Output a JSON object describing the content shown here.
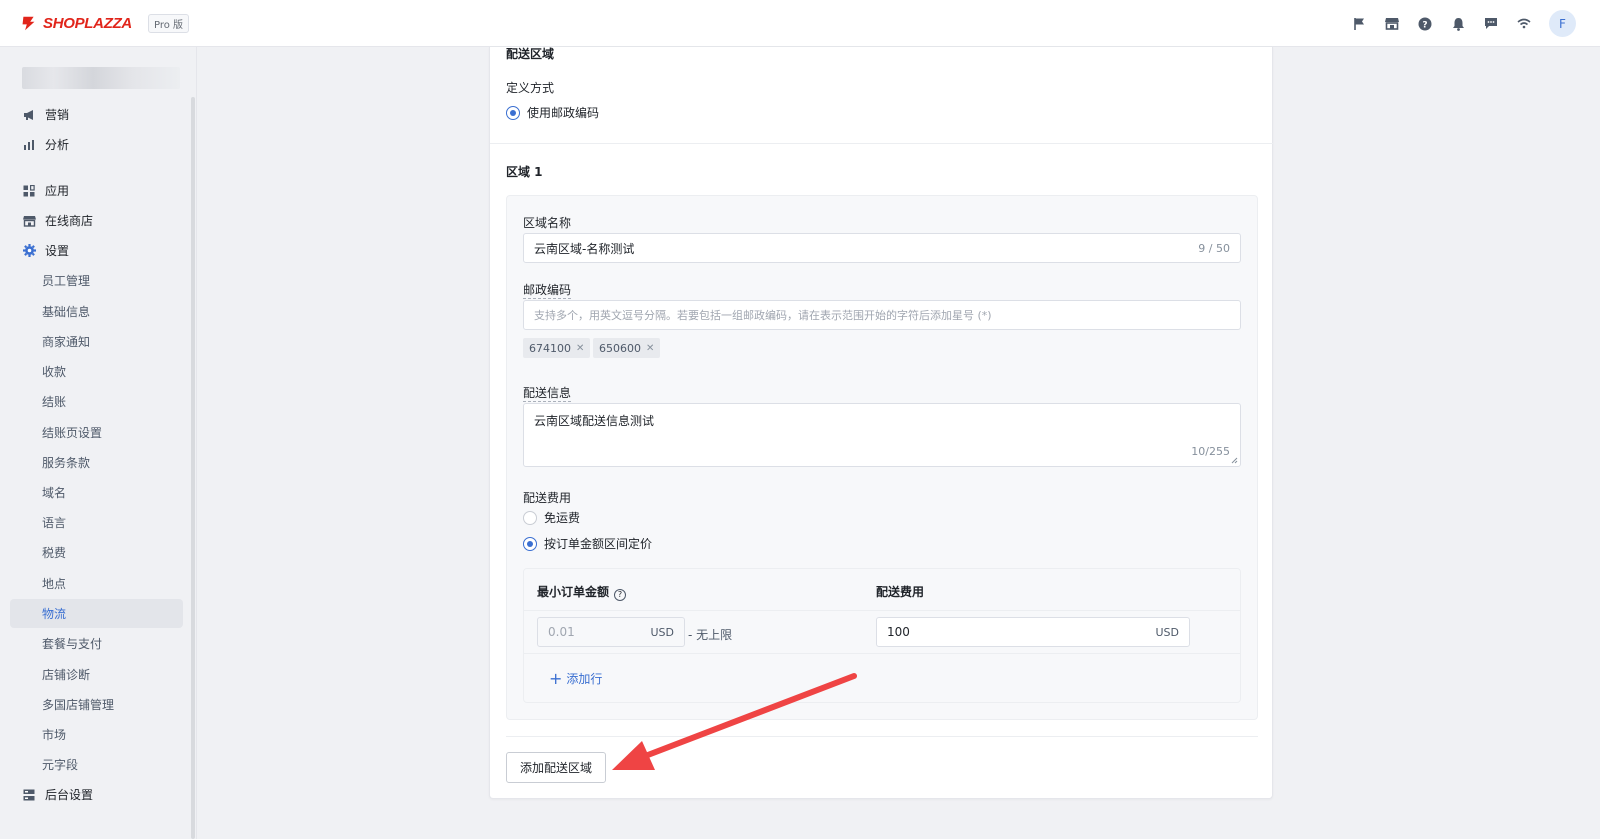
{
  "header": {
    "brand": "SHOPLAZZA",
    "plan_badge": "Pro 版",
    "avatar_letter": "F",
    "icons": [
      "flag-icon",
      "store-icon",
      "help-icon",
      "bell-icon",
      "message-icon",
      "wifi-icon"
    ]
  },
  "sidebar": {
    "top_items": [
      {
        "label": "营销",
        "icon": "megaphone-icon"
      },
      {
        "label": "分析",
        "icon": "bar-chart-icon"
      }
    ],
    "group2": [
      {
        "label": "应用",
        "icon": "apps-icon"
      },
      {
        "label": "在线商店",
        "icon": "store-icon"
      },
      {
        "label": "设置",
        "icon": "gear-icon"
      }
    ],
    "settings_sub": [
      "员工管理",
      "基础信息",
      "商家通知",
      "收款",
      "结账",
      "结账页设置",
      "服务条款",
      "域名",
      "语言",
      "税费",
      "地点",
      "物流",
      "套餐与支付",
      "店铺诊断",
      "多国店铺管理",
      "市场",
      "元字段"
    ],
    "active_sub": "物流",
    "bottom_item": {
      "label": "后台设置",
      "icon": "server-icon"
    }
  },
  "zone": {
    "section_title": "配送区域",
    "define_label": "定义方式",
    "define_option": "使用邮政编码",
    "region_title": "区域 1",
    "name_label": "区域名称",
    "name_value": "云南区域-名称测试",
    "name_counter": "9 / 50",
    "postal_label": "邮政编码",
    "postal_placeholder": "支持多个，用英文逗号分隔。若要包括一组邮政编码，请在表示范围开始的字符后添加星号 (*)",
    "postal_tags": [
      "674100",
      "650600"
    ],
    "info_label": "配送信息",
    "info_value": "云南区域配送信息测试",
    "info_counter": "10/255",
    "fee_label": "配送费用",
    "fee_options": [
      {
        "label": "免运费",
        "selected": false
      },
      {
        "label": "按订单金额区间定价",
        "selected": true
      }
    ],
    "table": {
      "col_min": "最小订单金额",
      "col_fee": "配送费用",
      "min_placeholder": "0.01",
      "currency": "USD",
      "range_text": "- 无上限",
      "fee_value": "100",
      "add_row": "添加行"
    },
    "add_zone_button": "添加配送区域"
  },
  "colors": {
    "accent": "#3a6fd1",
    "brand": "#e1251b",
    "annotation_arrow": "#ef4444"
  }
}
